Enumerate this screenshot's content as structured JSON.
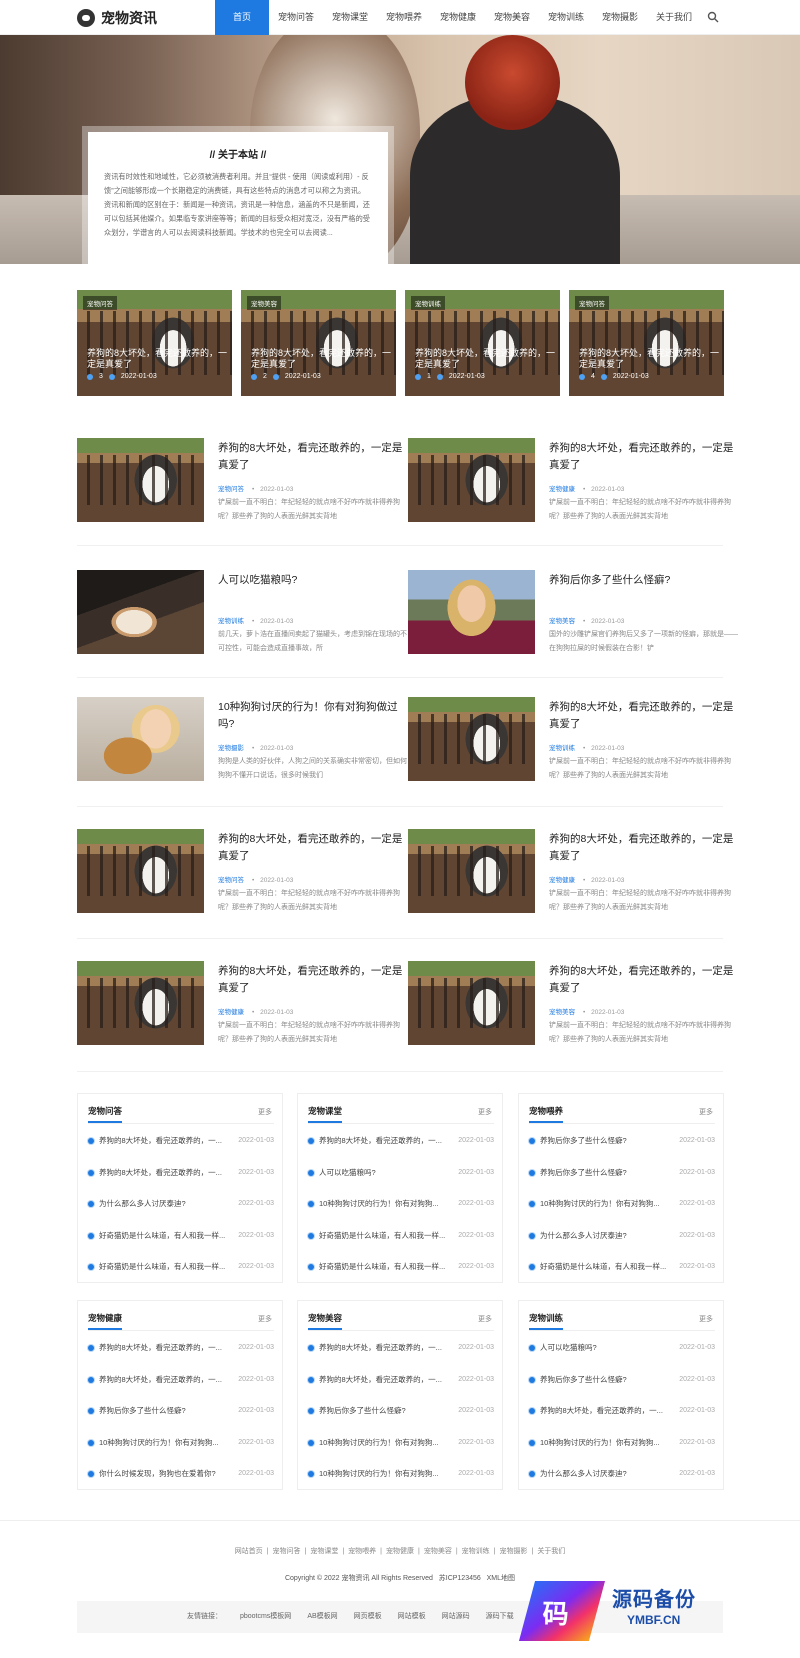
{
  "header": {
    "logo": "宠物资讯",
    "nav": [
      "首页",
      "宠物问答",
      "宠物课堂",
      "宠物喂养",
      "宠物健康",
      "宠物美容",
      "宠物训练",
      "宠物摄影",
      "关于我们"
    ],
    "active": 0
  },
  "about": {
    "title": "// 关于本站 //",
    "text": "资讯有时效性和地域性，它必须被消费者利用。并且“提供 - 使用（阅读或利用）- 反馈”之间能够形成一个长期稳定的消费链，具有这些特点的消息才可以称之为资讯。资讯和新闻的区别在于：新闻是一种资讯，资讯是一种信息，涵盖的不只是新闻，还可以包括其他媒介。如果临专家讲座等等；新闻的目标受众相对宽泛，没有严格的受众划分，学谱言的人可以去阅读科技新闻。学技术的也完全可以去阅读..."
  },
  "cards": [
    {
      "tag": "宠物问答",
      "title": "养狗的8大坏处，看完还敢养的，一定是真爱了",
      "views": "3",
      "date": "2022-01-03"
    },
    {
      "tag": "宠物美容",
      "title": "养狗的8大坏处，看完还敢养的，一定是真爱了",
      "views": "2",
      "date": "2022-01-03"
    },
    {
      "tag": "宠物训练",
      "title": "养狗的8大坏处，看完还敢养的，一定是真爱了",
      "views": "1",
      "date": "2022-01-03"
    },
    {
      "tag": "宠物问答",
      "title": "养狗的8大坏处，看完还敢养的，一定是真爱了",
      "views": "4",
      "date": "2022-01-03"
    }
  ],
  "articles": [
    {
      "title": "养狗的8大坏处，看完还敢养的，一定是真爱了",
      "cat": "宠物问答",
      "date": "2022-01-03",
      "desc": "铲屎前一直不明白：年纪轻轻的就点啥不好咋咋就非得养狗呢？那些养了狗的人表面光鲜其实背地",
      "img": "husky"
    },
    {
      "title": "养狗的8大坏处，看完还敢养的，一定是真爱了",
      "cat": "宠物健康",
      "date": "2022-01-03",
      "desc": "铲屎前一直不明白：年纪轻轻的就点啥不好咋咋就非得养狗呢？那些养了狗的人表面光鲜其实背地",
      "img": "husky"
    },
    {
      "title": "人可以吃猫粮吗?",
      "cat": "宠物训练",
      "date": "2022-01-03",
      "desc": "前几天，萝卜浩在直播间卖起了猫罐头，考虑到锦在现场的不可控性，可能会造成直播事故，所",
      "img": "cat"
    },
    {
      "title": "养狗后你多了些什么怪癖?",
      "cat": "宠物美容",
      "date": "2022-01-03",
      "desc": "国外的沙雕铲屎官们养狗后又多了一项新的怪癖，那就是——在狗狗拉屎的时候假装在合影！铲",
      "img": "woman"
    },
    {
      "title": "10种狗狗讨厌的行为！你有对狗狗做过吗?",
      "cat": "宠物摄影",
      "date": "2022-01-03",
      "desc": "狗狗是人类的好伙伴，人狗之间的关系确实非常密切，但如何狗狗不懂开口说话，很多时候我们",
      "img": "golden"
    },
    {
      "title": "养狗的8大坏处，看完还敢养的，一定是真爱了",
      "cat": "宠物训练",
      "date": "2022-01-03",
      "desc": "铲屎前一直不明白：年纪轻轻的就点啥不好咋咋就非得养狗呢？那些养了狗的人表面光鲜其实背地",
      "img": "husky"
    },
    {
      "title": "养狗的8大坏处，看完还敢养的，一定是真爱了",
      "cat": "宠物问答",
      "date": "2022-01-03",
      "desc": "铲屎前一直不明白：年纪轻轻的就点啥不好咋咋就非得养狗呢？那些养了狗的人表面光鲜其实背地",
      "img": "husky"
    },
    {
      "title": "养狗的8大坏处，看完还敢养的，一定是真爱了",
      "cat": "宠物健康",
      "date": "2022-01-03",
      "desc": "铲屎前一直不明白：年纪轻轻的就点啥不好咋咋就非得养狗呢？那些养了狗的人表面光鲜其实背地",
      "img": "husky"
    },
    {
      "title": "养狗的8大坏处，看完还敢养的，一定是真爱了",
      "cat": "宠物健康",
      "date": "2022-01-03",
      "desc": "铲屎前一直不明白：年纪轻轻的就点啥不好咋咋就非得养狗呢？那些养了狗的人表面光鲜其实背地",
      "img": "husky"
    },
    {
      "title": "养狗的8大坏处，看完还敢养的，一定是真爱了",
      "cat": "宠物美容",
      "date": "2022-01-03",
      "desc": "铲屎前一直不明白：年纪轻轻的就点啥不好咋咋就非得养狗呢？那些养了狗的人表面光鲜其实背地",
      "img": "husky"
    }
  ],
  "boxes": [
    {
      "title": "宠物问答",
      "more": "更多",
      "rows": [
        [
          "养狗的8大坏处，看完还敢养的，一...",
          "2022-01-03"
        ],
        [
          "养狗的8大坏处，看完还敢养的，一...",
          "2022-01-03"
        ],
        [
          "为什么那么多人讨厌泰迪?",
          "2022-01-03"
        ],
        [
          "好奇猫奶是什么味道，有人和我一样...",
          "2022-01-03"
        ],
        [
          "好奇猫奶是什么味道，有人和我一样...",
          "2022-01-03"
        ]
      ]
    },
    {
      "title": "宠物课堂",
      "more": "更多",
      "rows": [
        [
          "养狗的8大坏处，看完还敢养的，一...",
          "2022-01-03"
        ],
        [
          "人可以吃猫粮吗?",
          "2022-01-03"
        ],
        [
          "10种狗狗讨厌的行为！你有对狗狗...",
          "2022-01-03"
        ],
        [
          "好奇猫奶是什么味道，有人和我一样...",
          "2022-01-03"
        ],
        [
          "好奇猫奶是什么味道，有人和我一样...",
          "2022-01-03"
        ]
      ]
    },
    {
      "title": "宠物喂养",
      "more": "更多",
      "rows": [
        [
          "养狗后你多了些什么怪癖?",
          "2022-01-03"
        ],
        [
          "养狗后你多了些什么怪癖?",
          "2022-01-03"
        ],
        [
          "10种狗狗讨厌的行为！你有对狗狗...",
          "2022-01-03"
        ],
        [
          "为什么那么多人讨厌泰迪?",
          "2022-01-03"
        ],
        [
          "好奇猫奶是什么味道，有人和我一样...",
          "2022-01-03"
        ]
      ]
    },
    {
      "title": "宠物健康",
      "more": "更多",
      "rows": [
        [
          "养狗的8大坏处，看完还敢养的，一...",
          "2022-01-03"
        ],
        [
          "养狗的8大坏处，看完还敢养的，一...",
          "2022-01-03"
        ],
        [
          "养狗后你多了些什么怪癖?",
          "2022-01-03"
        ],
        [
          "10种狗狗讨厌的行为！你有对狗狗...",
          "2022-01-03"
        ],
        [
          "你什么时候发现，狗狗也在爱着你?",
          "2022-01-03"
        ]
      ]
    },
    {
      "title": "宠物美容",
      "more": "更多",
      "rows": [
        [
          "养狗的8大坏处，看完还敢养的，一...",
          "2022-01-03"
        ],
        [
          "养狗的8大坏处，看完还敢养的，一...",
          "2022-01-03"
        ],
        [
          "养狗后你多了些什么怪癖?",
          "2022-01-03"
        ],
        [
          "10种狗狗讨厌的行为！你有对狗狗...",
          "2022-01-03"
        ],
        [
          "10种狗狗讨厌的行为！你有对狗狗...",
          "2022-01-03"
        ]
      ]
    },
    {
      "title": "宠物训练",
      "more": "更多",
      "rows": [
        [
          "人可以吃猫粮吗?",
          "2022-01-03"
        ],
        [
          "养狗后你多了些什么怪癖?",
          "2022-01-03"
        ],
        [
          "养狗的8大坏处，看完还敢养的，一...",
          "2022-01-03"
        ],
        [
          "10种狗狗讨厌的行为！你有对狗狗...",
          "2022-01-03"
        ],
        [
          "为什么那么多人讨厌泰迪?",
          "2022-01-03"
        ]
      ]
    }
  ],
  "footer": {
    "nav": [
      "网站首页",
      "宠物问答",
      "宠物课堂",
      "宠物喂养",
      "宠物健康",
      "宠物美容",
      "宠物训练",
      "宠物摄影",
      "关于我们"
    ],
    "copyright": "Copyright © 2022 宠物资讯 All Rights Reserved",
    "icp": "苏ICP123456",
    "xml": "XML地图",
    "links_label": "友情链接：",
    "links": [
      "pbootcms模板网",
      "AB模板网",
      "网页模板",
      "网站模板",
      "网站源码",
      "源码下载"
    ]
  },
  "watermark": {
    "logo_char": "码",
    "name": "源码备份",
    "url": "YMBF.CN"
  },
  "colors": {
    "accent": "#1e7ae0"
  }
}
